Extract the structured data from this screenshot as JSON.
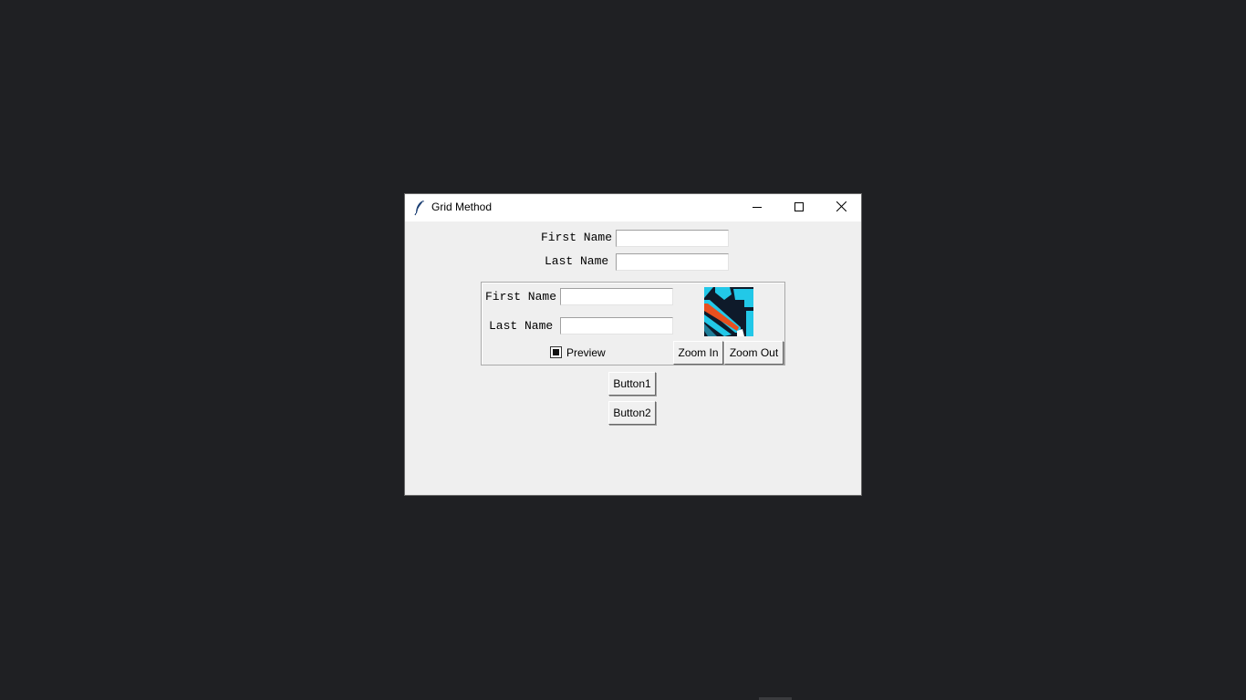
{
  "window": {
    "title": "Grid Method",
    "icon": "feather-icon",
    "controls": [
      "minimize-icon",
      "maximize-icon",
      "close-icon"
    ]
  },
  "top_form": {
    "first_name_label": "First Name",
    "first_name_value": "",
    "last_name_label": "Last Name",
    "last_name_value": ""
  },
  "frame": {
    "first_name_label": "First Name",
    "first_name_value": "",
    "last_name_label": "Last Name",
    "last_name_value": "",
    "preview_label": "Preview",
    "preview_checked": true,
    "zoom_in_label": "Zoom In",
    "zoom_out_label": "Zoom Out",
    "image_icon": "abstract-image-thumbnail"
  },
  "buttons": {
    "button1_label": "Button1",
    "button2_label": "Button2"
  },
  "colors": {
    "desktop": "#1f2023",
    "window_bg": "#efefef",
    "titlebar": "#ffffff",
    "thumb_cyan": "#22c8e8",
    "thumb_orange": "#e8501e",
    "thumb_dark": "#0e1a2a"
  }
}
